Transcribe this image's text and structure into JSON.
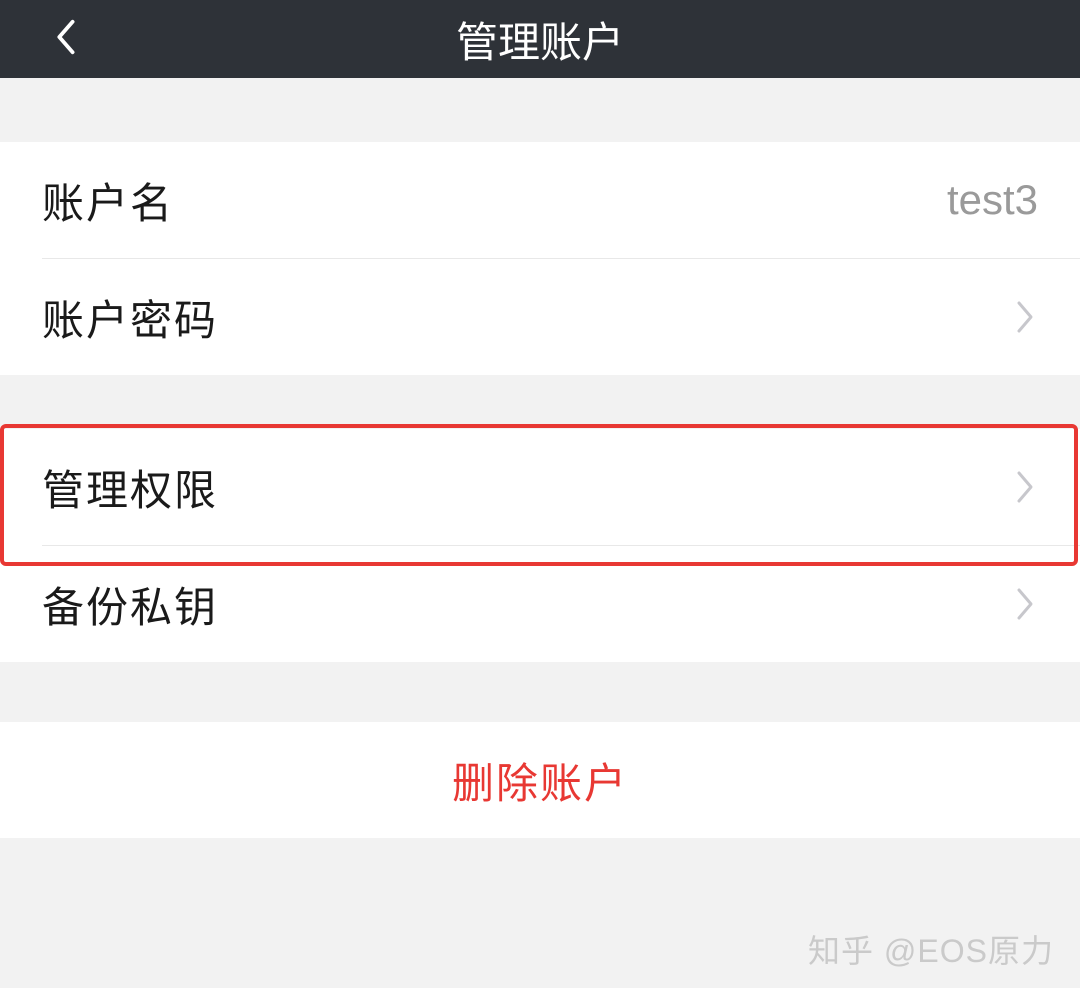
{
  "header": {
    "title": "管理账户"
  },
  "section1": {
    "account_name_label": "账户名",
    "account_name_value": "test3",
    "account_password_label": "账户密码"
  },
  "section2": {
    "manage_permissions_label": "管理权限",
    "backup_private_key_label": "备份私钥"
  },
  "actions": {
    "delete_account_label": "删除账户"
  },
  "watermark": "知乎 @EOS原力"
}
